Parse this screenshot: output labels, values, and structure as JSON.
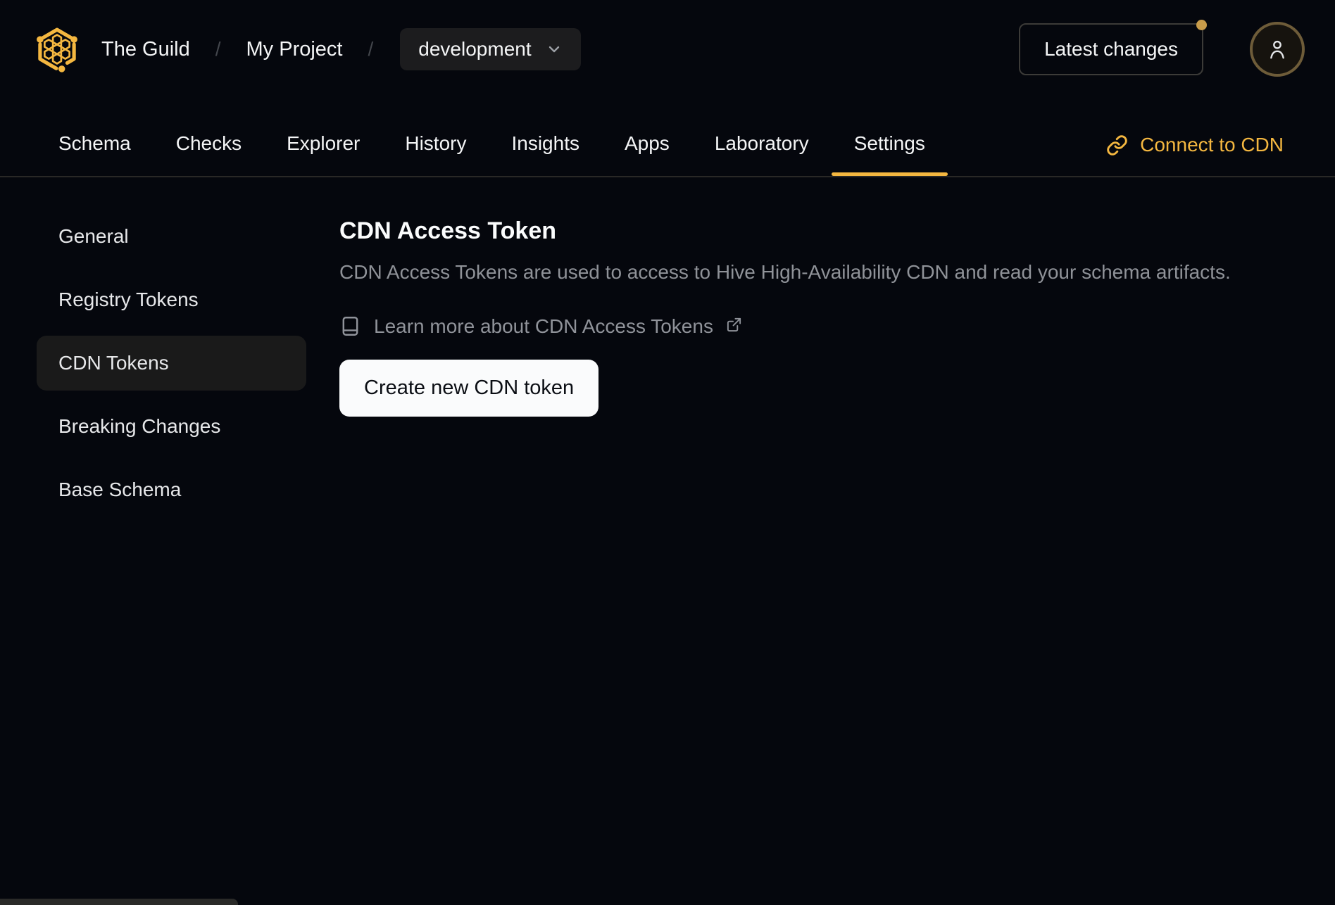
{
  "header": {
    "breadcrumb": {
      "org": "The Guild",
      "separator": "/",
      "project": "My Project"
    },
    "target_selector": {
      "value": "development"
    },
    "latest_changes_label": "Latest changes",
    "has_notification_dot": true
  },
  "tabs": [
    {
      "label": "Schema",
      "active": false
    },
    {
      "label": "Checks",
      "active": false
    },
    {
      "label": "Explorer",
      "active": false
    },
    {
      "label": "History",
      "active": false
    },
    {
      "label": "Insights",
      "active": false
    },
    {
      "label": "Apps",
      "active": false
    },
    {
      "label": "Laboratory",
      "active": false
    },
    {
      "label": "Settings",
      "active": true
    }
  ],
  "connect_cdn": {
    "label": "Connect to CDN",
    "icon": "link-icon"
  },
  "sidebar": {
    "items": [
      {
        "label": "General",
        "active": false
      },
      {
        "label": "Registry Tokens",
        "active": false
      },
      {
        "label": "CDN Tokens",
        "active": true
      },
      {
        "label": "Breaking Changes",
        "active": false
      },
      {
        "label": "Base Schema",
        "active": false
      }
    ]
  },
  "main": {
    "title": "CDN Access Token",
    "description": "CDN Access Tokens are used to access to Hive High-Availability CDN and read your schema artifacts.",
    "learn_more_label": "Learn more about CDN Access Tokens",
    "learn_more_icons": [
      "book-icon",
      "external-link-icon"
    ],
    "create_button_label": "Create new CDN token"
  },
  "icons": {
    "logo": "hive-hexagon-logo",
    "target_chevron": "chevron-down-icon",
    "user": "user-icon",
    "connect": "link-icon",
    "learn_more": "book-icon",
    "external": "external-link-icon",
    "notification": "notification-dot"
  },
  "colors": {
    "background": "#05070d",
    "accent": "#f4b740",
    "surface": "#1c1c1e",
    "surface_active": "#1a1a1a",
    "border": "#292826",
    "button_border": "#3c3b38",
    "text_primary": "#f4f5f6",
    "text_muted": "#8f9298",
    "separator": "#43464c",
    "white_button_bg": "#fafbfc",
    "white_button_text": "#0b0e14",
    "avatar_border": "#6e5c39",
    "notification_dot": "#c89c4a"
  }
}
